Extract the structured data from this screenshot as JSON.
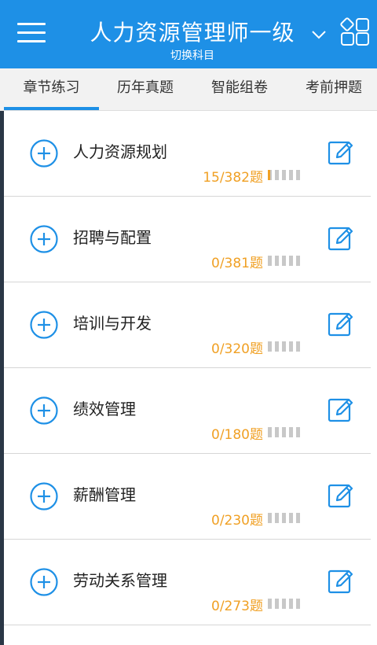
{
  "header": {
    "title": "人力资源管理师一级",
    "subtitle": "切换科目",
    "menu_icon": "hamburger-menu-icon",
    "dropdown_icon": "chevron-down-icon",
    "grid_icon": "grid-icon"
  },
  "tabs": [
    {
      "label": "章节练习",
      "active": true
    },
    {
      "label": "历年真题",
      "active": false
    },
    {
      "label": "智能组卷",
      "active": false
    },
    {
      "label": "考前押题",
      "active": false
    }
  ],
  "chapters": [
    {
      "title": "人力资源规划",
      "count": "15/382题",
      "progress": 0.039
    },
    {
      "title": "招聘与配置",
      "count": "0/381题",
      "progress": 0
    },
    {
      "title": "培训与开发",
      "count": "0/320题",
      "progress": 0
    },
    {
      "title": "绩效管理",
      "count": "0/180题",
      "progress": 0
    },
    {
      "title": "薪酬管理",
      "count": "0/230题",
      "progress": 0
    },
    {
      "title": "劳动关系管理",
      "count": "0/273题",
      "progress": 0
    }
  ],
  "colors": {
    "accent": "#1e90e6",
    "count": "#f0a024",
    "bar_empty": "#c8c8c8"
  }
}
